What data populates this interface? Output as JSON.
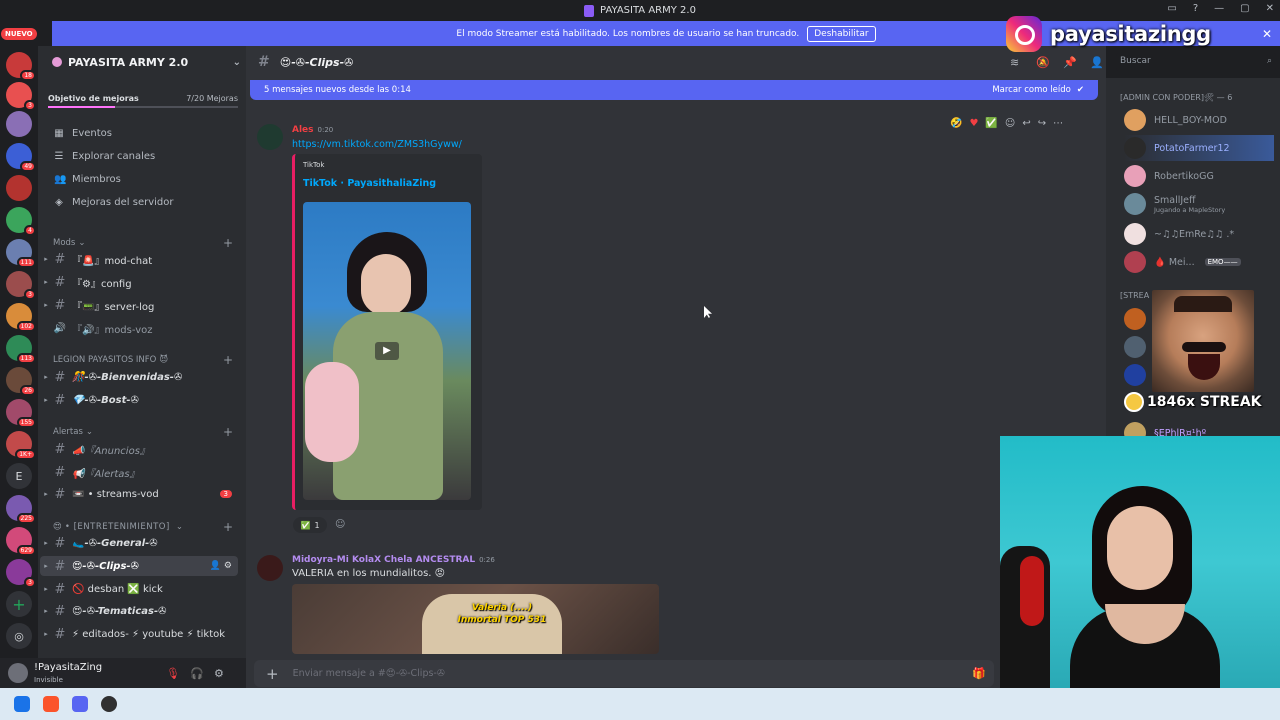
{
  "window": {
    "title": "PAYASITA ARMY 2.0"
  },
  "banner": {
    "text": "El modo Streamer está habilitado. Los nombres de usuario se han truncado.",
    "button": "Deshabilitar"
  },
  "rail": {
    "nuevo": "NUEVO",
    "badges": [
      "18",
      "3",
      "49",
      "4",
      "111",
      "3",
      "102",
      "113",
      "26",
      "155",
      "1K+",
      "225",
      "629",
      "3"
    ],
    "letter": "E"
  },
  "sidebar": {
    "server_name": "PAYASITA ARMY 2.0",
    "boost": {
      "label": "Objetivo de mejoras",
      "count": "7/20 Mejoras",
      "progress": 0.35
    },
    "nav": [
      {
        "label": "Eventos",
        "icon": "calendar-icon"
      },
      {
        "label": "Explorar canales",
        "icon": "browse-icon"
      },
      {
        "label": "Miembros",
        "icon": "members-icon"
      },
      {
        "label": "Mejoras del servidor",
        "icon": "boost-icon"
      }
    ],
    "categories": {
      "mods": "Mods",
      "legion": "LEGION PAYASITOS INFO",
      "alertas": "Alertas",
      "entretenimiento": "• [ENTRETENIMIENTO]"
    },
    "channels": {
      "mod_chat": "『🚨』mod-chat",
      "config": "『⚙』config",
      "server_log": "『📟』server-log",
      "mods_voz": "『🔊』mods-voz",
      "bienvenidas": "🎊-✇-Bienvenidas-✇",
      "bost": "💎-✇-Bost-✇",
      "anuncios": "📣『Anuncios』",
      "alertas": "📢『Alertas』",
      "streams_vod": "📼 • streams-vod",
      "streams_vod_badge": "3",
      "general": "🥿-✇-General-✇",
      "clips": "😍-✇-Clips-✇",
      "desban": "🚫 desban ❎ kick",
      "tematicas": "😍-✇-Tematicas-✇",
      "editados": "⚡ editados- ⚡ youtube ⚡ tiktok"
    },
    "user": {
      "name": "!PayasitaZing",
      "status": "Invisible"
    }
  },
  "header": {
    "channel": "😍-✇-Clips-✇",
    "search_placeholder": "Buscar"
  },
  "newbar": {
    "text": "5 mensajes nuevos desde las 0:14",
    "mark": "Marcar como leído"
  },
  "messages": [
    {
      "author": "Ales",
      "time": "0:20",
      "link": "https://vm.tiktok.com/ZMS3hGyww/",
      "embed": {
        "provider": "TikTok",
        "title": "TikTok · PayasithaliaZing"
      },
      "reaction": {
        "emoji": "✅",
        "count": "1"
      }
    },
    {
      "author": "Midoyra-Mi KolaX Chela ANCESTRAL",
      "time": "0:26",
      "text": "VALERIA en los mundialitos. 😡",
      "caption": "Valeria (....)\nInmortal TOP 531"
    }
  ],
  "composer": {
    "placeholder": "Enviar mensaje a #😍-✇-Clips-✇"
  },
  "members": {
    "role": "[ADMIN CON PODER]🛠 — 6",
    "list": [
      {
        "name": "HELL_BOY-MOD",
        "sub": ""
      },
      {
        "name": "PotatoFarmer12",
        "sub": ""
      },
      {
        "name": "RobertikoGG",
        "sub": ""
      },
      {
        "name": "SmallJeff",
        "sub": "Jugando a MapleStory"
      },
      {
        "name": "~♫♫EmRe♫♫ .*",
        "sub": ""
      },
      {
        "name": "🩸 Mei...",
        "sub": ""
      }
    ],
    "emo_tag": "EMO——",
    "stream_category": "[STREA",
    "last_member": "§EPhlR¤¹hº"
  },
  "overlay": {
    "instagram": "payasitazingg",
    "streak": "1846x STREAK"
  },
  "colors": {
    "accent": "#5865f2",
    "bg": "#313338",
    "sidebar": "#2b2d31",
    "rail": "#1e1f22",
    "link": "#00a8fc"
  }
}
